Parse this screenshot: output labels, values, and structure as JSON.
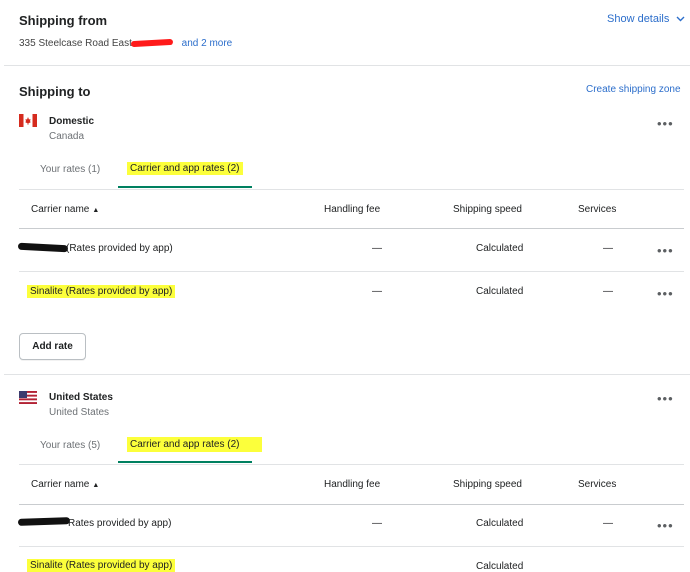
{
  "shipping_from": {
    "title": "Shipping from",
    "address": "335 Steelcase Road East",
    "and_more": "and 2 more",
    "show_details": "Show details"
  },
  "shipping_to": {
    "title": "Shipping to",
    "create_zone": "Create shipping zone"
  },
  "zones": [
    {
      "name": "Domestic",
      "country": "Canada",
      "flag_icon": "canada-flag-icon",
      "tabs": [
        {
          "label": "Your rates (1)",
          "active": false
        },
        {
          "label": "Carrier and app rates (2)",
          "active": true
        }
      ],
      "columns": [
        "Carrier name",
        "Handling fee",
        "Shipping speed",
        "Services"
      ],
      "rows": [
        {
          "name": "(Rates provided by app)",
          "handling": "—",
          "speed": "Calculated",
          "services": "—"
        },
        {
          "name": "Sinalite (Rates provided by app)",
          "handling": "—",
          "speed": "Calculated",
          "services": "—"
        }
      ],
      "add_rate": "Add rate"
    },
    {
      "name": "United States",
      "country": "United States",
      "flag_icon": "us-flag-icon",
      "tabs": [
        {
          "label": "Your rates (5)",
          "active": false
        },
        {
          "label": "Carrier and app rates (2)",
          "active": true
        }
      ],
      "columns": [
        "Carrier name",
        "Handling fee",
        "Shipping speed",
        "Services"
      ],
      "rows": [
        {
          "name": "Rates provided by app)",
          "handling": "—",
          "speed": "Calculated",
          "services": "—"
        },
        {
          "name": "Sinalite (Rates provided by app)",
          "handling": "",
          "speed": "Calculated",
          "services": ""
        }
      ]
    }
  ],
  "more_actions": "•••",
  "colors": {
    "highlight": "#fcff3b",
    "link": "#2c6ecb",
    "accent": "#008060"
  }
}
